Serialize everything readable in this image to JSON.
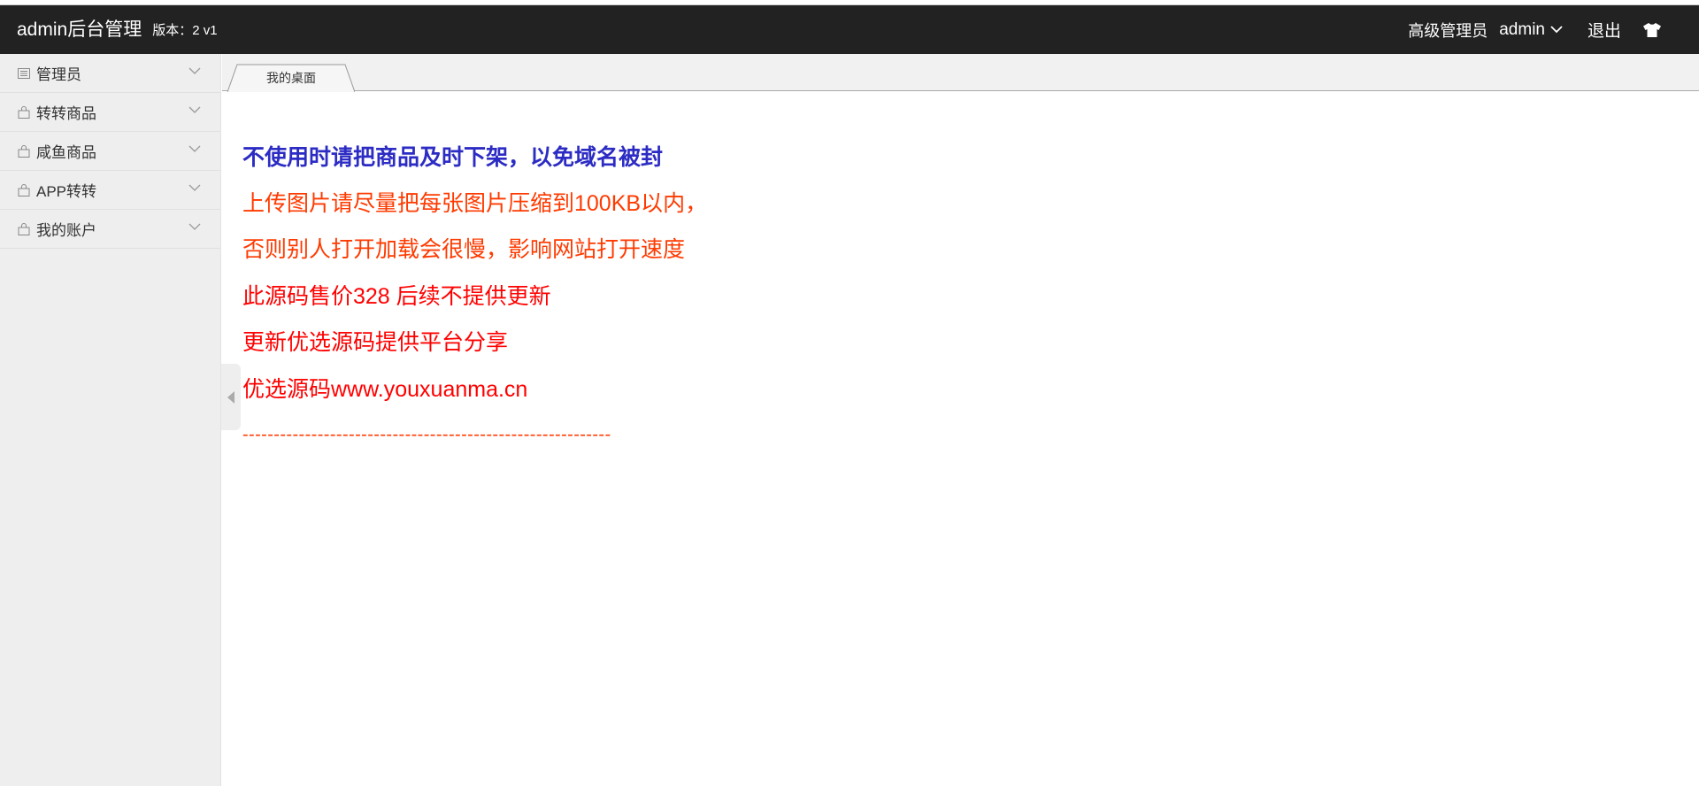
{
  "header": {
    "logo": "admin后台管理",
    "version": "版本：2 v1",
    "role": "高级管理员",
    "username": "admin",
    "logout": "退出",
    "skin_icon": "tshirt-icon"
  },
  "sidebar": {
    "items": [
      {
        "label": "管理员",
        "icon": "list-icon"
      },
      {
        "label": "转转商品",
        "icon": "bag-icon"
      },
      {
        "label": "咸鱼商品",
        "icon": "bag-icon"
      },
      {
        "label": "APP转转",
        "icon": "bag-icon"
      },
      {
        "label": "我的账户",
        "icon": "bag-icon"
      }
    ]
  },
  "tabs": [
    {
      "label": "我的桌面"
    }
  ],
  "content": {
    "lines": [
      "不使用时请把商品及时下架，以免域名被封",
      "上传图片请尽量把每张图片压缩到100KB以内，",
      "否则别人打开加载会很慢，影响网站打开速度",
      "此源码售价328 后续不提供更新",
      "更新优选源码提供平台分享",
      "优选源码www.youxuanma.cn"
    ],
    "divider": "-----------------------------------------------------------"
  },
  "colors": {
    "header_bg": "#222222",
    "notice_blue": "#2c2cc4",
    "notice_orange": "#ff3a00",
    "notice_red": "#ff0000",
    "sidebar_bg": "#eeeeee"
  }
}
